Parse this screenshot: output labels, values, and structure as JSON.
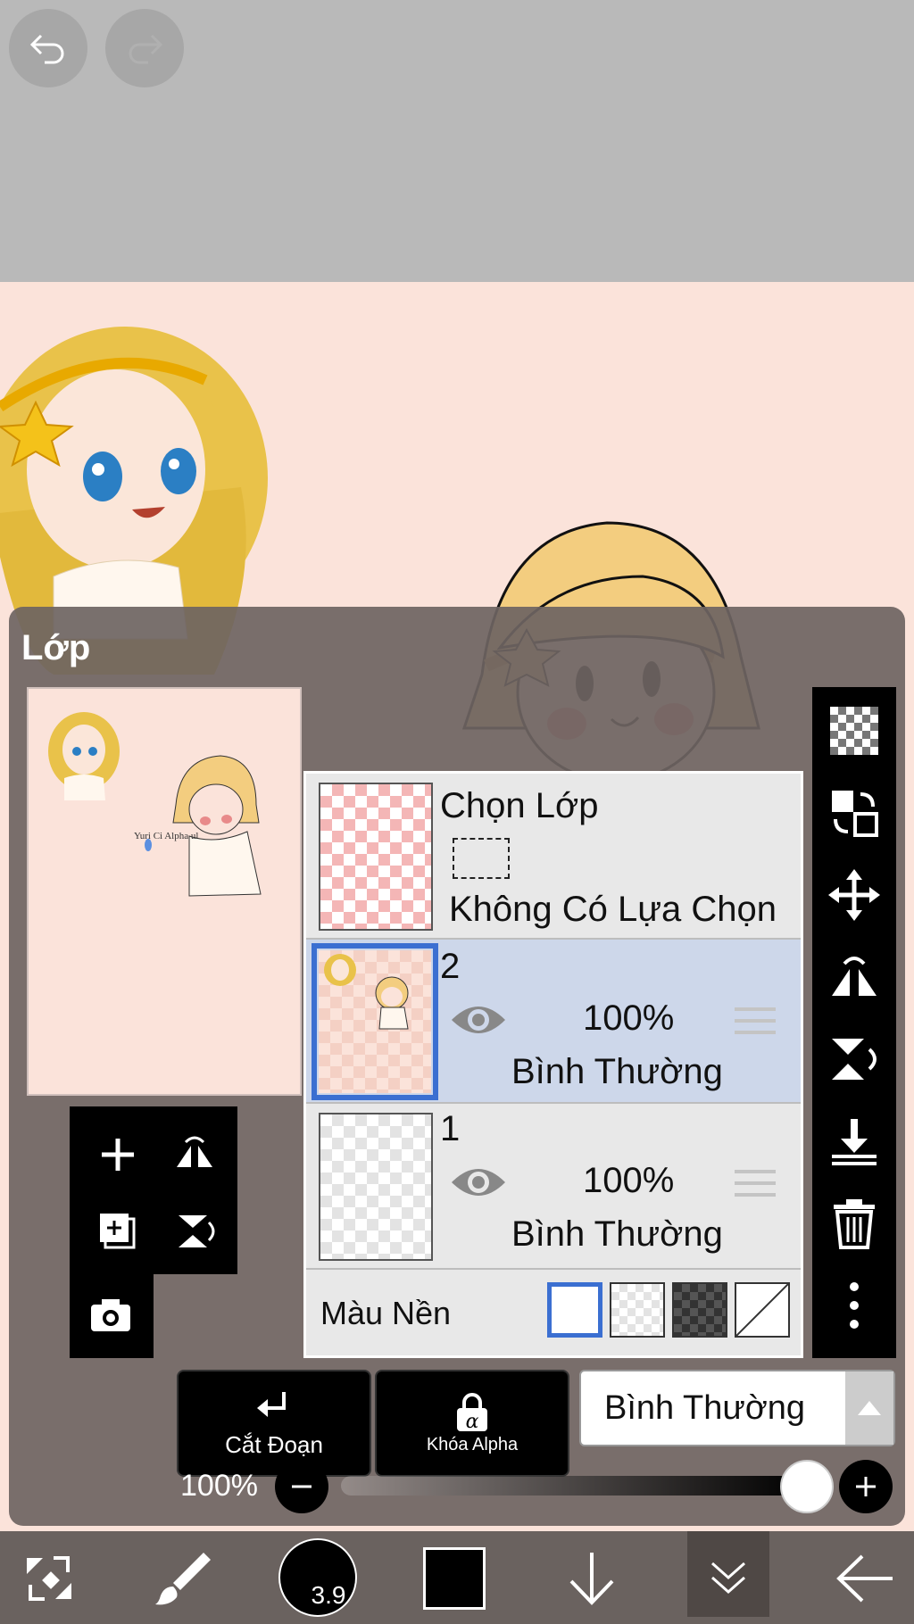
{
  "panel": {
    "title": "Lớp"
  },
  "layers": {
    "selection": {
      "title": "Chọn Lớp",
      "status": "Không Có Lựa Chọn"
    },
    "items": [
      {
        "name": "2",
        "opacity": "100%",
        "blend": "Bình Thường"
      },
      {
        "name": "1",
        "opacity": "100%",
        "blend": "Bình Thường"
      }
    ],
    "background_label": "Màu Nền"
  },
  "buttons": {
    "clipping": "Cắt Đoạn",
    "alpha_lock": "Khóa Alpha",
    "blend_mode": "Bình Thường"
  },
  "opacity": {
    "label": "100%",
    "value": 1.0
  },
  "brush": {
    "size": "3.9"
  },
  "thumbnail": {
    "signature": "Yuri Ci Alpha ul"
  },
  "colors": {
    "accent": "#3b6fd1",
    "canvas": "#fbe3da",
    "selected_row": "#cdd7ea",
    "primary_color": "#000000"
  }
}
